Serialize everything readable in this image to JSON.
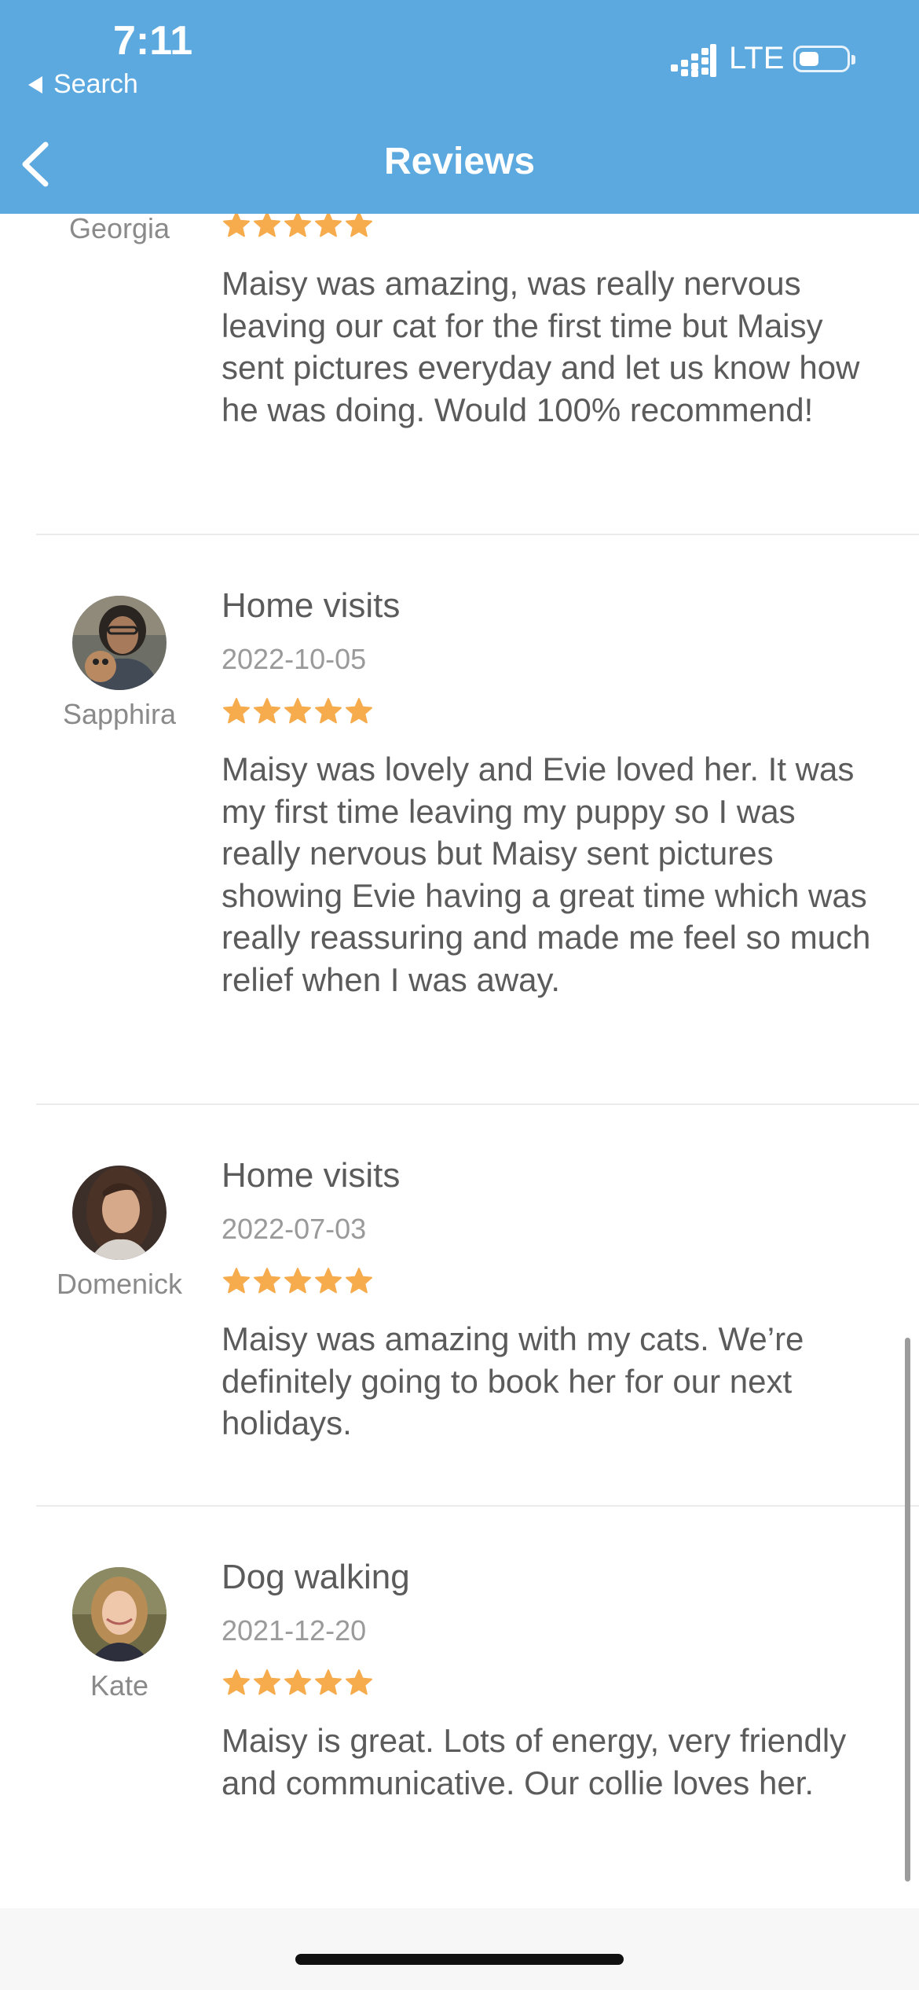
{
  "status_bar": {
    "time": "7:11",
    "back_app": "Search",
    "network": "LTE"
  },
  "nav": {
    "title": "Reviews"
  },
  "colors": {
    "header": "#5ca9e0",
    "star": "#f6ac4d",
    "text": "#5b5b5b"
  },
  "reviews": [
    {
      "reviewer": "Georgia",
      "rating": 5,
      "text": "Maisy was amazing, was really nervous leaving our cat for the first time but Maisy sent pictures everyday and let us know how he was doing. Would 100% recommend!"
    },
    {
      "reviewer": "Sapphira",
      "service": "Home visits",
      "date": "2022-10-05",
      "rating": 5,
      "text": "Maisy was lovely and Evie loved her. It was my first time leaving my puppy so I was really nervous but Maisy sent pictures showing Evie having a great time which was really reassuring and made me feel so much relief when I was away."
    },
    {
      "reviewer": "Domenick",
      "service": "Home visits",
      "date": "2022-07-03",
      "rating": 5,
      "text": "Maisy was amazing with my cats. We’re definitely going to book her for our next holidays."
    },
    {
      "reviewer": "Kate",
      "service": "Dog walking",
      "date": "2021-12-20",
      "rating": 5,
      "text": "Maisy is great. Lots of energy, very friendly and communicative. Our collie loves her."
    }
  ]
}
